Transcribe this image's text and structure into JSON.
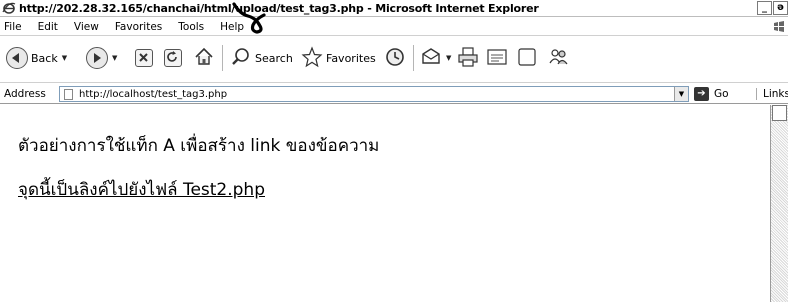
{
  "window": {
    "title": "http://202.28.32.165/chanchai/html/upload/test_tag3.php - Microsoft Internet Explorer",
    "controls": [
      "_",
      "ə",
      "×"
    ]
  },
  "menubar": {
    "items": [
      "File",
      "Edit",
      "View",
      "Favorites",
      "Tools",
      "Help"
    ]
  },
  "toolbar": {
    "back_label": "Back",
    "search_label": "Search",
    "favorites_label": "Favorites"
  },
  "addressbar": {
    "label": "Address",
    "url": "http://localhost/test_tag3.php",
    "go_label": "Go",
    "links_label": "Links"
  },
  "page": {
    "heading": "ตัวอย่างการใช้แท็ก A เพื่อสร้าง link ของข้อความ",
    "link_text": "จุดนี้เป็นลิงค์ไปยังไฟล์ Test2.php"
  }
}
